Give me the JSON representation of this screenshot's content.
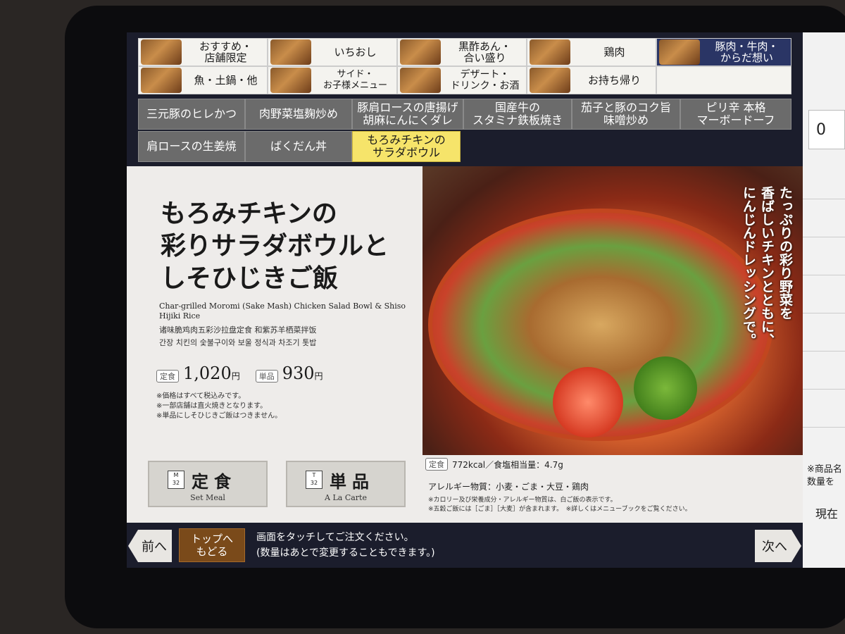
{
  "categories": [
    {
      "label": "おすすめ・\n店舗限定"
    },
    {
      "label": "いちおし"
    },
    {
      "label": "黒酢あん・\n合い盛り"
    },
    {
      "label": "鶏肉"
    },
    {
      "label": "豚肉・牛肉・\nからだ想い",
      "active": true
    },
    {
      "label": "魚・土鍋・他"
    },
    {
      "label": "サイド・\nお子様メニュー"
    },
    {
      "label": "デザート・\nドリンク・お酒"
    },
    {
      "label": "お持ち帰り"
    }
  ],
  "items": [
    {
      "label": "三元豚のヒレかつ"
    },
    {
      "label": "肉野菜塩麹炒め"
    },
    {
      "label": "豚肩ロースの唐揚げ\n胡麻にんにくダレ"
    },
    {
      "label": "国産牛の\nスタミナ鉄板焼き"
    },
    {
      "label": "茄子と豚のコク旨\n味噌炒め"
    },
    {
      "label": "ピリ辛 本格\nマーボードーフ"
    },
    {
      "label": "肩ロースの生姜焼"
    },
    {
      "label": "ばくだん丼"
    },
    {
      "label": "もろみチキンの\nサラダボウル",
      "active": true
    }
  ],
  "detail": {
    "title_lines": [
      "もろみチキンの",
      "彩りサラダボウルと",
      "しそひじきご飯"
    ],
    "english": "Char-grilled Moromi (Sake Mash) Chicken Salad Bowl & Shiso Hijiki Rice",
    "chinese": "诸味脆鸡肉五彩沙拉盘定食 和紫苏羊栖菜拌饭",
    "korean": "간장 치킨의 숯불구이와 보울 정식과 차조기 톳밥",
    "set_tag": "定食",
    "set_price": "1,020",
    "single_tag": "単品",
    "single_price": "930",
    "yen": "円",
    "notes": [
      "※価格はすべて税込みです。",
      "※一部店舗は直火焼きとなります。",
      "※単品にしそひじきご飯はつきません。"
    ],
    "catchcopy": [
      "たっぷりの彩り野菜を",
      "香ばしいチキンとともに、",
      "にんじんドレッシングで。"
    ],
    "nutrition_tag": "定食",
    "nutrition": "772kcal／食塩相当量：4.7g",
    "allergy": "アレルギー物質：小麦・ごま・大豆・鶏肉",
    "footnotes": [
      "※カロリー及び栄養成分・アレルギー物質は、白ご飯の表示です。",
      "※五穀ご飯には［ごま］［大麦］が含まれます。　※詳しくはメニューブックをご覧ください。"
    ]
  },
  "buttons": {
    "set_meal": {
      "code": "M\n32",
      "label": "定食",
      "sub": "Set Meal"
    },
    "a_la_carte": {
      "code": "T\n32",
      "label": "単品",
      "sub": "A La Carte"
    }
  },
  "bottom": {
    "prev": "前へ",
    "top": "トップへ\nもどる",
    "instruction_1": "画面をタッチしてご注文ください。",
    "instruction_2": "(数量はあとで変更することもできます。)",
    "next": "次へ"
  },
  "side": {
    "count": "0",
    "note_1": "※商品名",
    "note_2": "数量を",
    "now": "現在"
  },
  "colors": {
    "active_category": "#2a3565",
    "active_item": "#f6e46a",
    "top_button": "#7a4a1a"
  }
}
